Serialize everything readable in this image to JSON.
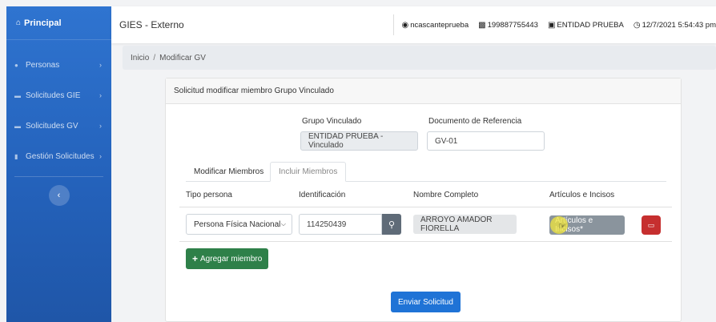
{
  "sidebar": {
    "brand": {
      "icon": "home-icon",
      "label": "Principal"
    },
    "items": [
      {
        "icon": "user-icon",
        "label": "Personas"
      },
      {
        "icon": "folder-icon",
        "label": "Solicitudes GIE"
      },
      {
        "icon": "folder-icon",
        "label": "Solicitudes GV"
      },
      {
        "icon": "document-icon",
        "label": "Gestión Solicitudes"
      }
    ],
    "collapse_icon": "chevron-left-icon"
  },
  "topbar": {
    "app_title": "GIES - Externo",
    "username": "ncascanteprueba",
    "id_number": "199887755443",
    "entity": "ENTIDAD PRUEBA",
    "datetime": "12/7/2021 5:54:43 pm"
  },
  "breadcrumb": {
    "home": "Inicio",
    "separator": "/",
    "current": "Modificar GV"
  },
  "card": {
    "title": "Solicitud modificar miembro Grupo Vinculado",
    "grupo_label": "Grupo Vinculado",
    "grupo_value": "ENTIDAD PRUEBA - Vinculado",
    "doc_label": "Documento de Referencia",
    "doc_value": "GV-01",
    "tabs": [
      "Modificar Miembros",
      "Incluir Miembros"
    ],
    "columns": [
      "Tipo persona",
      "Identificación",
      "Nombre Completo",
      "Artículos e Incisos"
    ],
    "row": {
      "tipo": "Persona Física Nacional",
      "identificacion": "114250439",
      "nombre": "ARROYO AMADOR FIORELLA",
      "articulos_button": "Artículos e Incisos*"
    },
    "add_button": "Agregar miembro",
    "submit_button": "Enviar Solicitud"
  },
  "colors": {
    "sidebar": "#2462bb",
    "primary": "#1f73d6",
    "success": "#2e8049",
    "danger": "#c62f2f",
    "secondary": "#8a949d"
  }
}
